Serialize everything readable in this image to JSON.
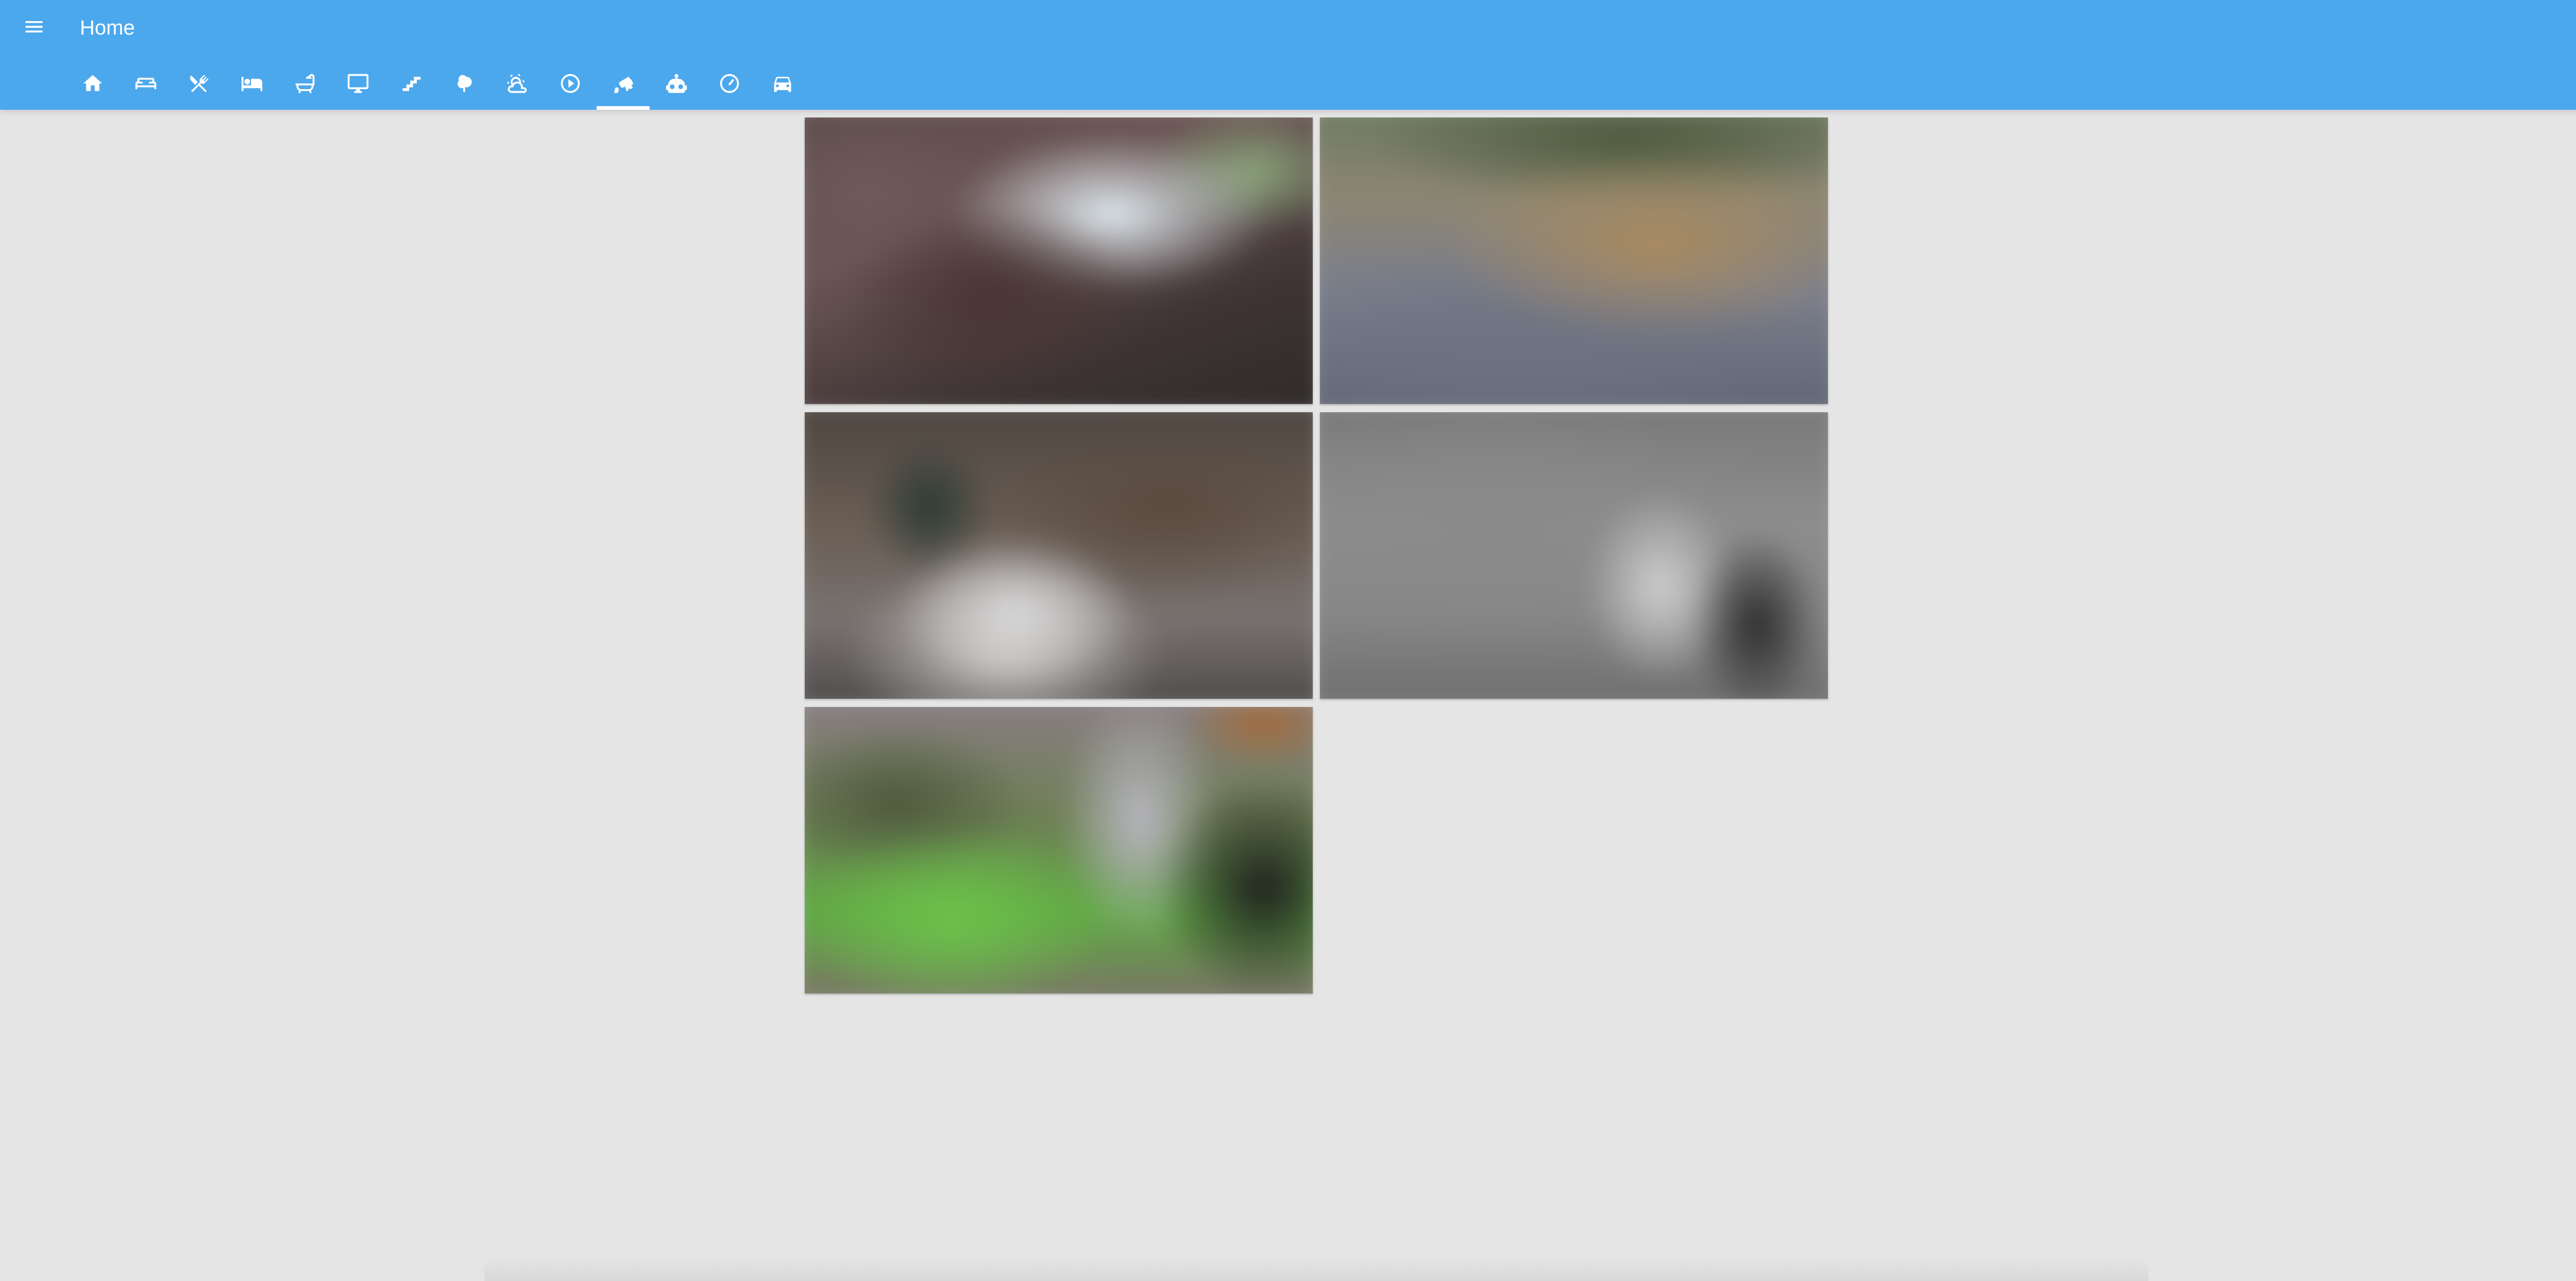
{
  "header": {
    "title": "Home",
    "menu_icon": "menu-icon",
    "background_color": "#4ca8ed"
  },
  "tabs": [
    {
      "icon": "home-icon",
      "active": false
    },
    {
      "icon": "sofa-icon",
      "active": false
    },
    {
      "icon": "silverware-icon",
      "active": false
    },
    {
      "icon": "bed-icon",
      "active": false
    },
    {
      "icon": "bathtub-icon",
      "active": false
    },
    {
      "icon": "monitor-icon",
      "active": false
    },
    {
      "icon": "stairs-icon",
      "active": false
    },
    {
      "icon": "tree-icon",
      "active": false
    },
    {
      "icon": "weather-partly-cloudy-icon",
      "active": false
    },
    {
      "icon": "play-circle-icon",
      "active": false
    },
    {
      "icon": "cctv-icon",
      "active": true
    },
    {
      "icon": "robot-icon",
      "active": false
    },
    {
      "icon": "gauge-icon",
      "active": false
    },
    {
      "icon": "car-icon",
      "active": false
    }
  ],
  "cameras": [
    {
      "name": "camera-feed-1"
    },
    {
      "name": "camera-feed-2"
    },
    {
      "name": "camera-feed-3"
    },
    {
      "name": "camera-feed-4"
    },
    {
      "name": "camera-feed-5"
    }
  ]
}
